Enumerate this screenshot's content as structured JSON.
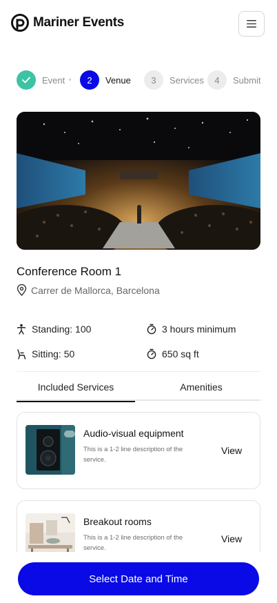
{
  "app": {
    "name": "Mariner Events"
  },
  "stepper": {
    "steps": [
      {
        "number": "",
        "label": "Event",
        "state": "done"
      },
      {
        "number": "2",
        "label": "Venue",
        "state": "active"
      },
      {
        "number": "3",
        "label": "Services",
        "state": "todo"
      },
      {
        "number": "4",
        "label": "Submit",
        "state": "todo"
      }
    ]
  },
  "venue": {
    "title": "Conference Room 1",
    "location": "Carrer de Mallorca, Barcelona",
    "specs": {
      "standing": "Standing: 100",
      "minimum": "3 hours minimum",
      "sitting": "Sitting: 50",
      "area": "650 sq ft"
    }
  },
  "tabs": [
    "Included Services",
    "Amenities"
  ],
  "services": [
    {
      "title": "Audio-visual equipment",
      "description": "This is a 1-2 line description of the service.",
      "action": "View"
    },
    {
      "title": "Breakout rooms",
      "description": "This is a 1-2 line description of the service.",
      "action": "View"
    }
  ],
  "cta": {
    "label": "Select Date and Time"
  },
  "colors": {
    "primary": "#0a0ae6",
    "done": "#3cc3a3"
  }
}
